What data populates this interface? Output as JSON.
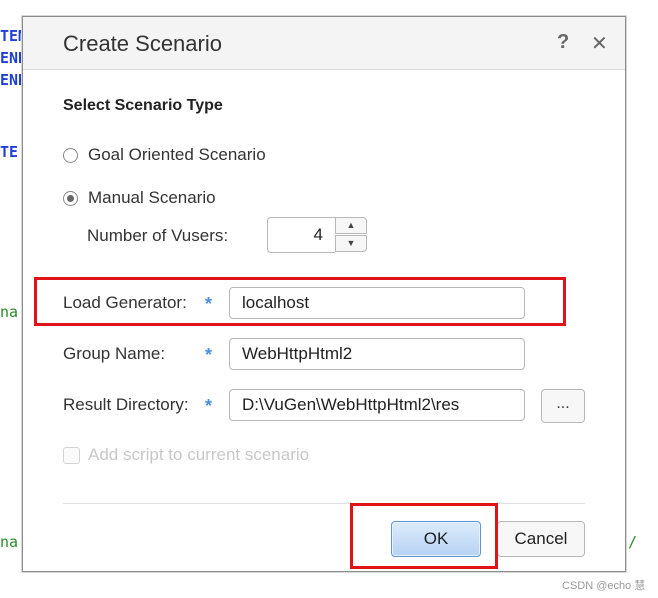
{
  "background": {
    "code_fragments": [
      {
        "text": "TEM",
        "color": "#1f3fd6"
      },
      {
        "text": "END",
        "color": "#1f3fd6"
      },
      {
        "text": "END",
        "color": "#1f3fd6"
      },
      {
        "text": "TE",
        "color": "#1f3fd6"
      },
      {
        "text": "na",
        "color": "#2a8a2a"
      },
      {
        "text": "na",
        "color": "#2a8a2a"
      },
      {
        "text": "/",
        "color": "#2a8a2a"
      }
    ]
  },
  "dialog": {
    "title": "Create Scenario",
    "help_glyph": "?",
    "close_glyph": "✕",
    "section_title": "Select Scenario Type",
    "scenario_types": [
      {
        "label": "Goal Oriented Scenario",
        "selected": false
      },
      {
        "label": "Manual Scenario",
        "selected": true
      }
    ],
    "vusers": {
      "label": "Number of Vusers:",
      "value": "4",
      "up_glyph": "▲",
      "down_glyph": "▼"
    },
    "required_marker": "*",
    "fields": {
      "load_generator": {
        "label": "Load Generator:",
        "value": "localhost"
      },
      "group_name": {
        "label": "Group Name:",
        "value": "WebHttpHtml2"
      },
      "result_directory": {
        "label": "Result Directory:",
        "value": "D:\\VuGen\\WebHttpHtml2\\res"
      }
    },
    "browse_label": "...",
    "add_script_label": "Add script to current scenario",
    "ok_label": "OK",
    "cancel_label": "Cancel"
  },
  "watermark": "CSDN @echo 慧",
  "colors": {
    "highlight": "#e0131b",
    "required": "#4a8fe0",
    "ok_border": "#5f95d6"
  }
}
